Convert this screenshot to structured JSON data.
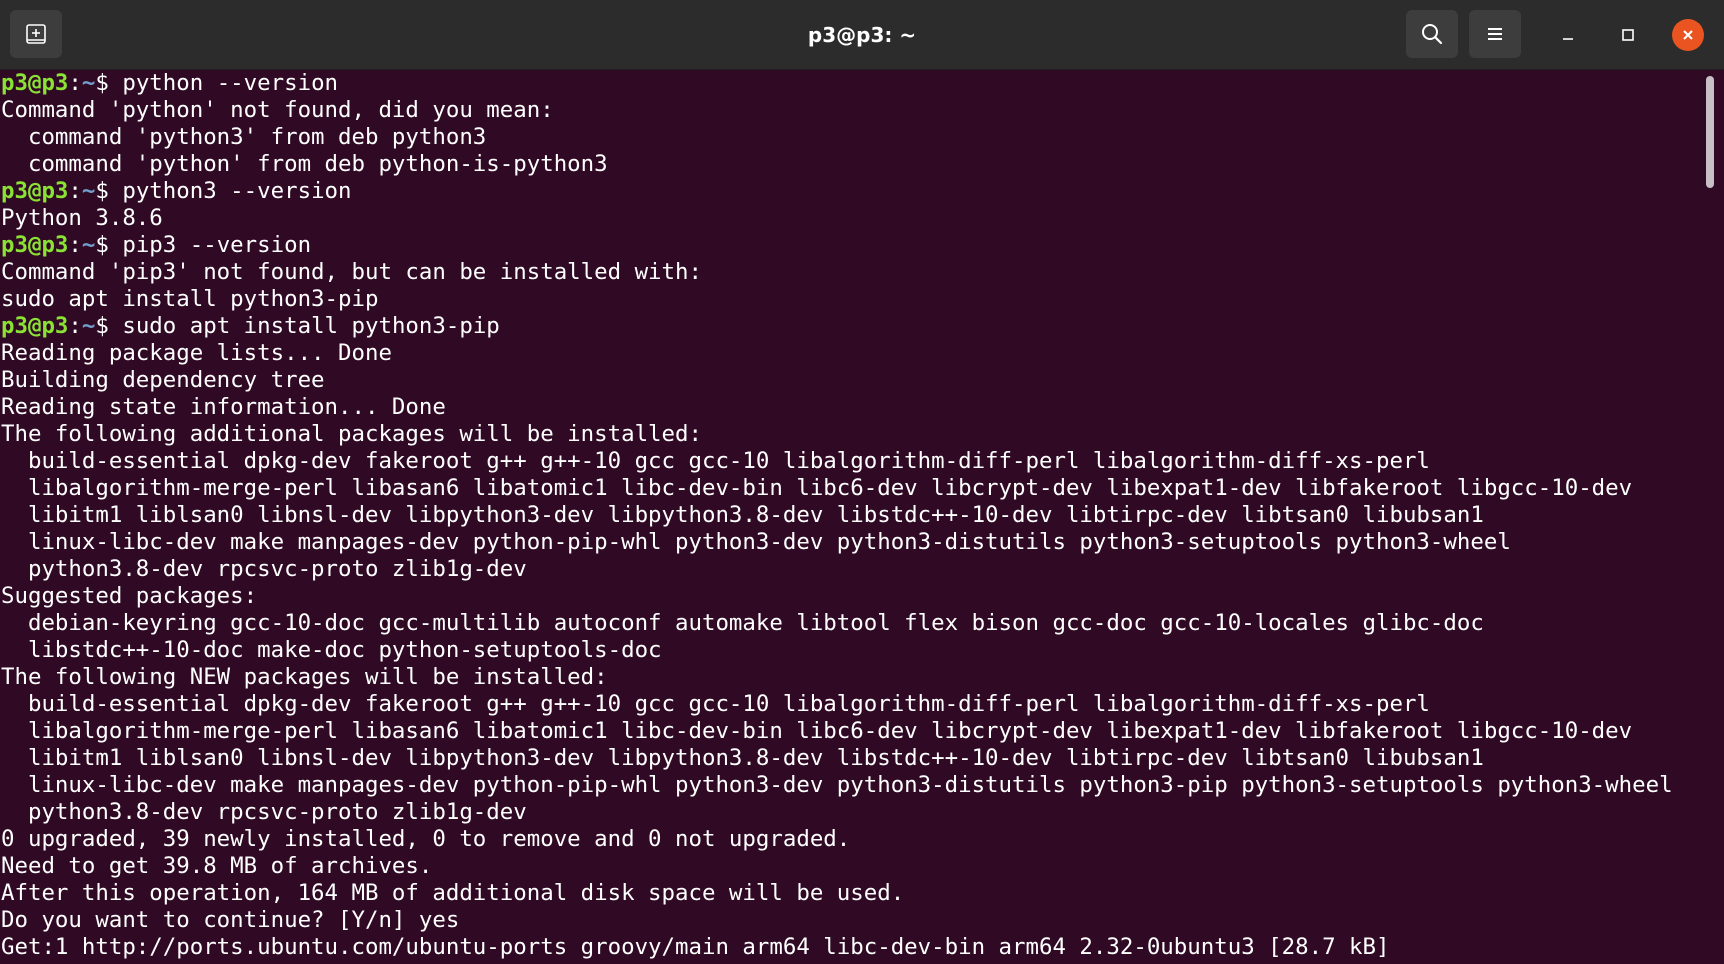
{
  "window": {
    "title": "p3@p3: ~",
    "accent_color": "#e95420",
    "background_color": "#300a24"
  },
  "toolbar": {
    "new_tab_icon": "new-tab-icon",
    "search_icon": "search-icon",
    "menu_icon": "hamburger-menu-icon",
    "minimize_icon": "minimize-icon",
    "maximize_icon": "maximize-icon",
    "close_icon": "close-icon"
  },
  "prompt": {
    "user_host": "p3@p3",
    "separator": ":",
    "path": "~",
    "symbol": "$ "
  },
  "terminal": {
    "lines": [
      {
        "type": "prompt",
        "text": "python --version"
      },
      {
        "type": "output",
        "text": "Command 'python' not found, did you mean:"
      },
      {
        "type": "output",
        "text": "  command 'python3' from deb python3"
      },
      {
        "type": "output",
        "text": "  command 'python' from deb python-is-python3"
      },
      {
        "type": "prompt",
        "text": "python3 --version"
      },
      {
        "type": "output",
        "text": "Python 3.8.6"
      },
      {
        "type": "prompt",
        "text": "pip3 --version"
      },
      {
        "type": "output",
        "text": "Command 'pip3' not found, but can be installed with:"
      },
      {
        "type": "output",
        "text": "sudo apt install python3-pip"
      },
      {
        "type": "prompt",
        "text": "sudo apt install python3-pip"
      },
      {
        "type": "output",
        "text": "Reading package lists... Done"
      },
      {
        "type": "output",
        "text": "Building dependency tree"
      },
      {
        "type": "output",
        "text": "Reading state information... Done"
      },
      {
        "type": "output",
        "text": "The following additional packages will be installed:"
      },
      {
        "type": "output",
        "text": "  build-essential dpkg-dev fakeroot g++ g++-10 gcc gcc-10 libalgorithm-diff-perl libalgorithm-diff-xs-perl"
      },
      {
        "type": "output",
        "text": "  libalgorithm-merge-perl libasan6 libatomic1 libc-dev-bin libc6-dev libcrypt-dev libexpat1-dev libfakeroot libgcc-10-dev"
      },
      {
        "type": "output",
        "text": "  libitm1 liblsan0 libnsl-dev libpython3-dev libpython3.8-dev libstdc++-10-dev libtirpc-dev libtsan0 libubsan1"
      },
      {
        "type": "output",
        "text": "  linux-libc-dev make manpages-dev python-pip-whl python3-dev python3-distutils python3-setuptools python3-wheel"
      },
      {
        "type": "output",
        "text": "  python3.8-dev rpcsvc-proto zlib1g-dev"
      },
      {
        "type": "output",
        "text": "Suggested packages:"
      },
      {
        "type": "output",
        "text": "  debian-keyring gcc-10-doc gcc-multilib autoconf automake libtool flex bison gcc-doc gcc-10-locales glibc-doc"
      },
      {
        "type": "output",
        "text": "  libstdc++-10-doc make-doc python-setuptools-doc"
      },
      {
        "type": "output",
        "text": "The following NEW packages will be installed:"
      },
      {
        "type": "output",
        "text": "  build-essential dpkg-dev fakeroot g++ g++-10 gcc gcc-10 libalgorithm-diff-perl libalgorithm-diff-xs-perl"
      },
      {
        "type": "output",
        "text": "  libalgorithm-merge-perl libasan6 libatomic1 libc-dev-bin libc6-dev libcrypt-dev libexpat1-dev libfakeroot libgcc-10-dev"
      },
      {
        "type": "output",
        "text": "  libitm1 liblsan0 libnsl-dev libpython3-dev libpython3.8-dev libstdc++-10-dev libtirpc-dev libtsan0 libubsan1"
      },
      {
        "type": "output",
        "text": "  linux-libc-dev make manpages-dev python-pip-whl python3-dev python3-distutils python3-pip python3-setuptools python3-wheel"
      },
      {
        "type": "output",
        "text": "  python3.8-dev rpcsvc-proto zlib1g-dev"
      },
      {
        "type": "output",
        "text": "0 upgraded, 39 newly installed, 0 to remove and 0 not upgraded."
      },
      {
        "type": "output",
        "text": "Need to get 39.8 MB of archives."
      },
      {
        "type": "output",
        "text": "After this operation, 164 MB of additional disk space will be used."
      },
      {
        "type": "output",
        "text": "Do you want to continue? [Y/n] yes"
      },
      {
        "type": "output",
        "text": "Get:1 http://ports.ubuntu.com/ubuntu-ports groovy/main arm64 libc-dev-bin arm64 2.32-0ubuntu3 [28.7 kB]"
      }
    ]
  }
}
